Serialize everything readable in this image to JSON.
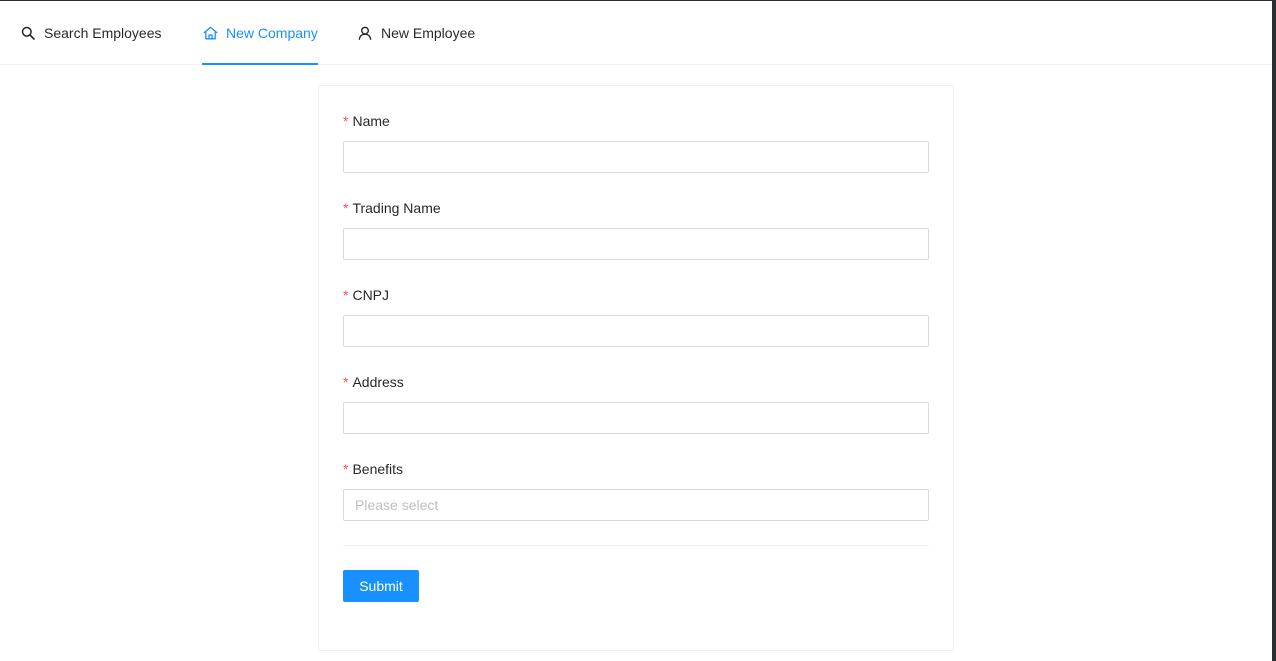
{
  "nav": {
    "items": [
      {
        "label": "Search Employees",
        "icon": "search-icon",
        "active": false
      },
      {
        "label": "New Company",
        "icon": "home-icon",
        "active": true
      },
      {
        "label": "New Employee",
        "icon": "user-icon",
        "active": false
      }
    ]
  },
  "form": {
    "required_mark": "*",
    "fields": [
      {
        "label": "Name",
        "value": ""
      },
      {
        "label": "Trading Name",
        "value": ""
      },
      {
        "label": "CNPJ",
        "value": ""
      },
      {
        "label": "Address",
        "value": ""
      }
    ],
    "benefits": {
      "label": "Benefits",
      "placeholder": "Please select"
    },
    "submit_label": "Submit"
  },
  "colors": {
    "accent": "#1890ff",
    "required": "#ff4d4f",
    "border": "#d9d9d9"
  }
}
